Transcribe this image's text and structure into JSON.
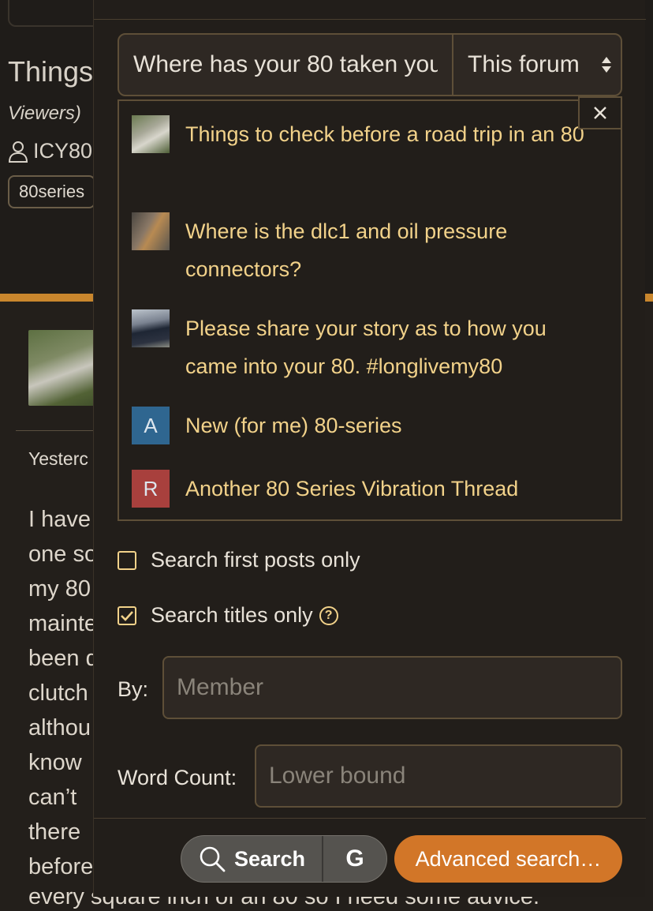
{
  "background": {
    "thread_title": "Things",
    "viewers": "Viewers)",
    "username": "ICY80",
    "tag": "80series",
    "post_date": "Yesterc",
    "post_lines": [
      "I have",
      "one so",
      "my 80",
      "mainte",
      "been d",
      "clutch",
      "althou",
      "know",
      "can’t",
      "there",
      "before"
    ],
    "post_last_line": "every square inch of an 80 so I need some advice."
  },
  "search": {
    "query": "Where has your 80 taken you",
    "scope": "This forum",
    "close_label": "×"
  },
  "results": [
    {
      "title": "Things to check before a road trip in an 80",
      "thumb": "photo"
    },
    {
      "title": "Where is the dlc1 and oil pressure connectors?",
      "thumb": "photo"
    },
    {
      "title": "Please share your story as to how you came into your 80. #longlivemy80",
      "thumb": "photo"
    },
    {
      "title": "New (for me) 80-series",
      "thumb_letter": "A",
      "thumb_color": "#2f6690"
    },
    {
      "title": "Another 80 Series Vibration Thread",
      "thumb_letter": "R",
      "thumb_color": "#a8403d"
    }
  ],
  "options": {
    "first_posts_label": "Search first posts only",
    "first_posts_checked": false,
    "titles_only_label": "Search titles only",
    "titles_only_checked": true,
    "help_glyph": "?"
  },
  "fields": {
    "by_label": "By:",
    "by_placeholder": "Member",
    "word_count_label": "Word Count:",
    "word_count_placeholder": "Lower bound"
  },
  "buttons": {
    "search_label": "Search",
    "google_label": "G",
    "advanced_label": "Advanced search…"
  },
  "colors": {
    "accent": "#c9862d",
    "link": "#f2d28a",
    "advanced_button": "#d27628"
  }
}
